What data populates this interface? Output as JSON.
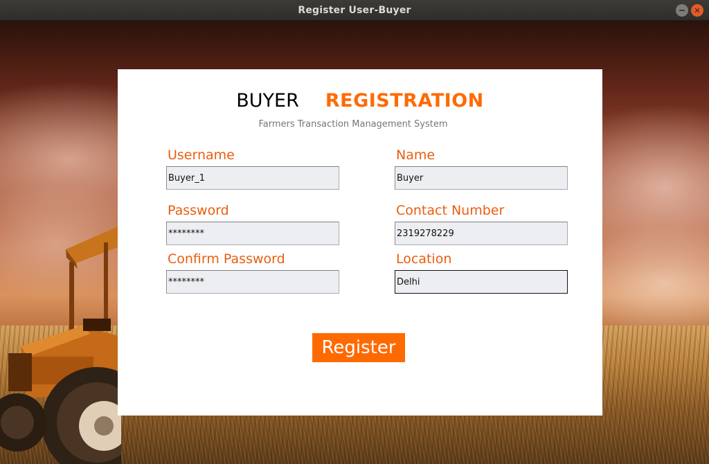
{
  "window": {
    "title": "Register User-Buyer"
  },
  "heading": {
    "part1": "BUYER",
    "part2": "REGISTRATION"
  },
  "subtitle": "Farmers Transaction Management System",
  "form": {
    "username": {
      "label": "Username",
      "value": "Buyer_1"
    },
    "name": {
      "label": "Name",
      "value": "Buyer"
    },
    "password": {
      "label": "Password",
      "value": "********"
    },
    "contact": {
      "label": "Contact Number",
      "value": "2319278229"
    },
    "confirm_password": {
      "label": "Confirm Password",
      "value": "********"
    },
    "location": {
      "label": "Location",
      "value": "Delhi"
    }
  },
  "register_label": "Register",
  "colors": {
    "accent": "#ff6a00",
    "label": "#ea5d0f",
    "panel": "#ffffff",
    "input_bg": "#eceef1"
  },
  "icons": {
    "minimize": "minimize-icon",
    "close": "close-icon"
  }
}
